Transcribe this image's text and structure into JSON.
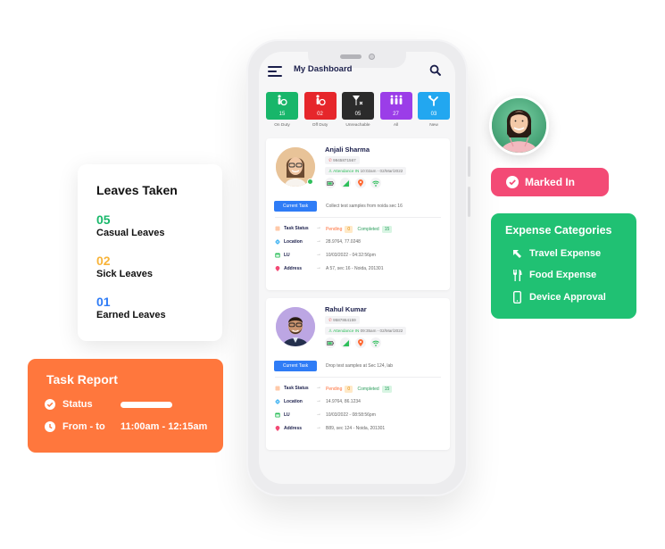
{
  "app": {
    "title": "My Dashboard",
    "menu_icon": "hamburger-menu-icon",
    "search_icon": "search-icon"
  },
  "stats": [
    {
      "label": "On Duty",
      "count": "15",
      "color": "#18b66a",
      "icon": "person-check-icon"
    },
    {
      "label": "Off Duty",
      "count": "02",
      "color": "#e6262b",
      "icon": "person-off-icon"
    },
    {
      "label": "Unreachable",
      "count": "05",
      "color": "#2b2b2b",
      "icon": "no-signal-icon"
    },
    {
      "label": "All",
      "count": "27",
      "color": "#9b3de8",
      "icon": "group-icon"
    },
    {
      "label": "New",
      "count": "03",
      "color": "#22a7f0",
      "icon": "new-user-icon"
    }
  ],
  "employees": [
    {
      "name": "Anjali Sharma",
      "phone": "9945871567",
      "attendance_label": "Attendance IN",
      "attendance_time": "10:02am - 02/Mar/2022",
      "online": true,
      "current_task_label": "Current Task",
      "task_description": "Collect test samples from noida sec 16",
      "task_status_label": "Task Status",
      "pending_label": "Pending",
      "pending_count": "0",
      "completed_label": "Completed",
      "completed_count": "15",
      "location_label": "Location",
      "location": "28.9764, 77.0248",
      "lu_label": "LU",
      "lu": "10/03/2022  -  04:32:56pm",
      "address_label": "Address",
      "address": "A 57, sec 16 - Noida, 201301"
    },
    {
      "name": "Rahul Kumar",
      "phone": "9587864159",
      "attendance_label": "Attendance IN",
      "attendance_time": "09:35am - 02/Mar/2022",
      "online": false,
      "current_task_label": "Current Task",
      "task_description": "Drop test samples at Sec 124, lab",
      "task_status_label": "Task Status",
      "pending_label": "Pending",
      "pending_count": "0",
      "completed_label": "Completed",
      "completed_count": "15",
      "location_label": "Location",
      "location": "14.9764, 86.1234",
      "lu_label": "LU",
      "lu": "10/03/2022  -  08:58:56pm",
      "address_label": "Address",
      "address": "B89, sec 124 - Noida, 201301"
    }
  ],
  "leaves": {
    "title": "Leaves Taken",
    "items": [
      {
        "count": "05",
        "label": "Casual Leaves",
        "color": "#19b86b"
      },
      {
        "count": "02",
        "label": "Sick Leaves",
        "color": "#f8b43a"
      },
      {
        "count": "01",
        "label": "Earned Leaves",
        "color": "#2f7cf6"
      }
    ]
  },
  "task_report": {
    "title": "Task Report",
    "status_label": "Status",
    "from_to_label": "From - to",
    "from_to_value": "11:00am - 12:15am",
    "color": "#ff773d"
  },
  "marked_in": {
    "label": "Marked In",
    "color": "#f34a75"
  },
  "expense": {
    "title": "Expense Categories",
    "items": [
      {
        "label": "Travel Expense",
        "icon": "arrow-up-left-icon"
      },
      {
        "label": "Food Expense",
        "icon": "fork-knife-icon"
      },
      {
        "label": "Device Approval",
        "icon": "mobile-device-icon"
      }
    ],
    "color": "#20c173"
  }
}
